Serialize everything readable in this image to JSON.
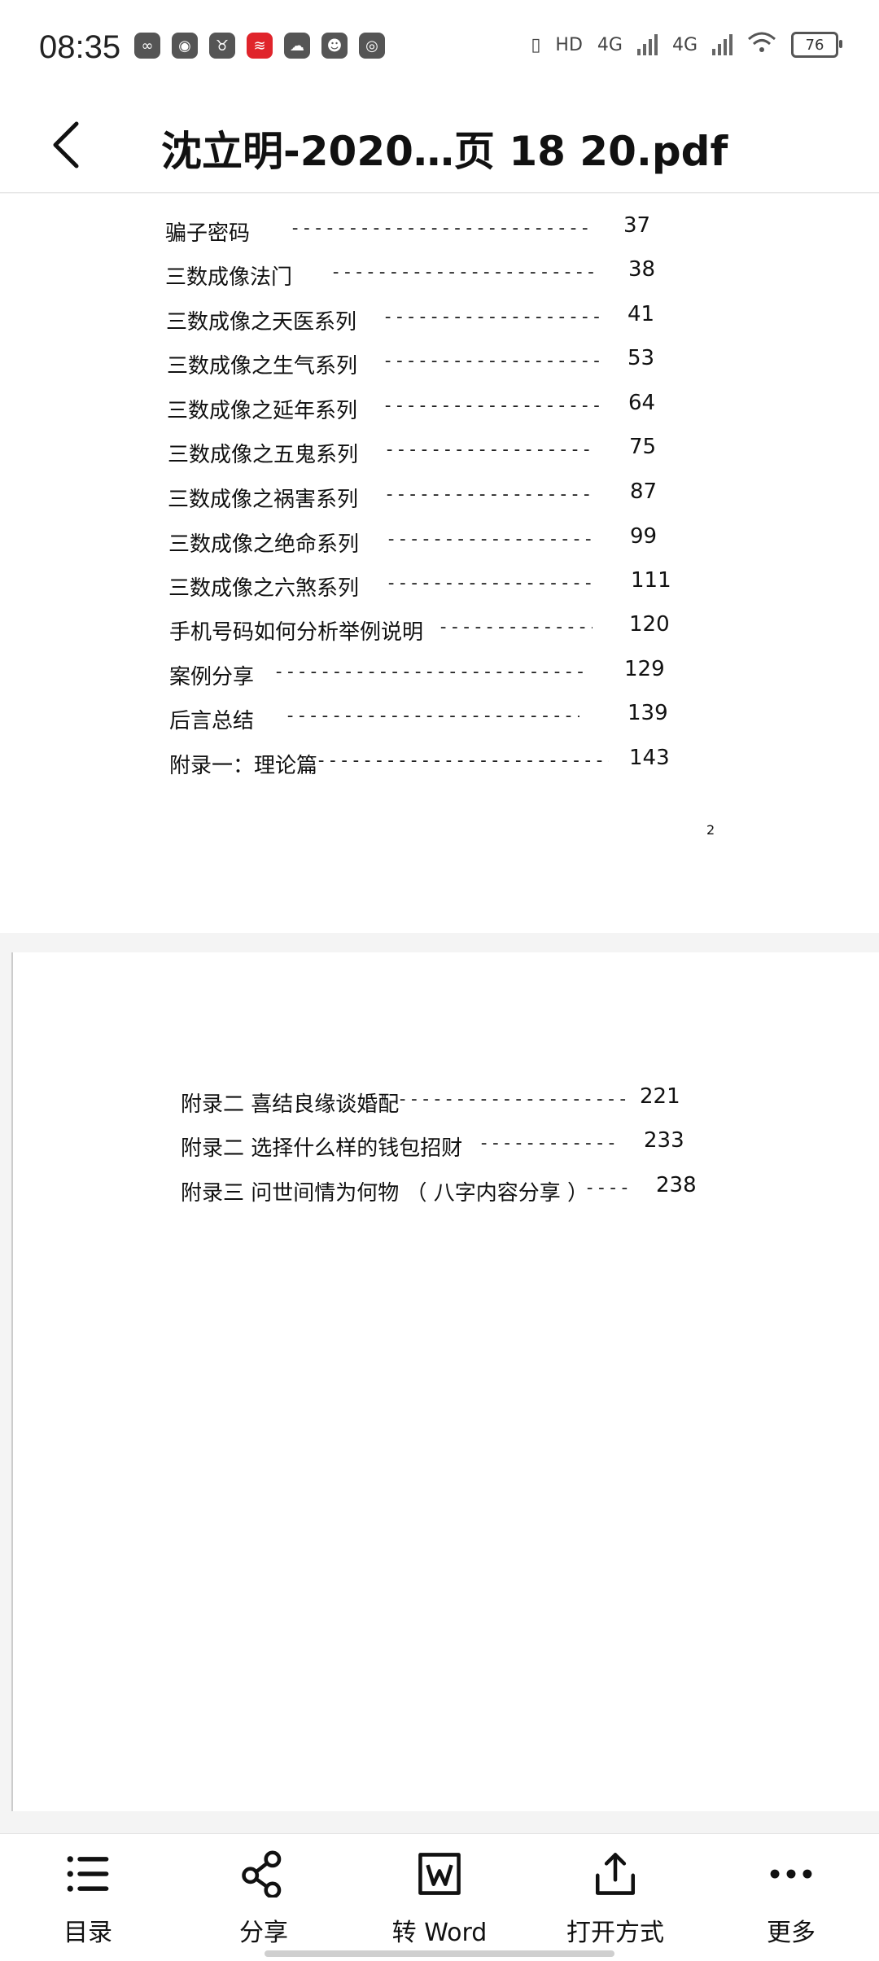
{
  "status_bar": {
    "time": "08:35",
    "battery": "76",
    "network1": "4G",
    "network2": "4G",
    "hd": "HD"
  },
  "title_bar": {
    "title": "沈立明-2020…页  18  20.pdf"
  },
  "page1": {
    "toc": [
      {
        "title": "骗子密码",
        "dots": "----------------------------------",
        "num": "37"
      },
      {
        "title": "三数成像法门",
        "dots": "------------------------------",
        "num": "38"
      },
      {
        "title": "三数成像之天医系列",
        "dots": "------------------------",
        "num": "41"
      },
      {
        "title": "三数成像之生气系列",
        "dots": "------------------------",
        "num": "53"
      },
      {
        "title": "三数成像之延年系列",
        "dots": "------------------------",
        "num": "64"
      },
      {
        "title": "三数成像之五鬼系列",
        "dots": "-----------------------",
        "num": "75"
      },
      {
        "title": "三数成像之祸害系列",
        "dots": "-----------------------",
        "num": "87"
      },
      {
        "title": "三数成像之绝命系列",
        "dots": "-----------------------",
        "num": "99"
      },
      {
        "title": "三数成像之六煞系列",
        "dots": "-----------------------",
        "num": "111"
      },
      {
        "title": "手机号码如何分析举例说明",
        "dots": "-----------------",
        "num": "120"
      },
      {
        "title": "案例分享",
        "dots": "-----------------------------------",
        "num": "129"
      },
      {
        "title": "后言总结",
        "dots": "---------------------------------",
        "num": "139"
      },
      {
        "title": "附录一：理论篇",
        "dots": "---------------------------------",
        "num": "143"
      }
    ],
    "page_number": "2"
  },
  "page2": {
    "toc": [
      {
        "title": "附录二  喜结良缘谈婚配",
        "dots": "------------------------",
        "num": "221"
      },
      {
        "title": "附录二  选择什么样的钱包招财",
        "dots": "--------------",
        "num": "233"
      },
      {
        "title": "附录三    问世间情为何物  （ 八字内容分享 ）",
        "dots": "----",
        "num": "238"
      }
    ]
  },
  "toolbar": {
    "toc_label": "目录",
    "share_label": "分享",
    "word_label": "转 Word",
    "open_label": "打开方式",
    "more_label": "更多"
  }
}
